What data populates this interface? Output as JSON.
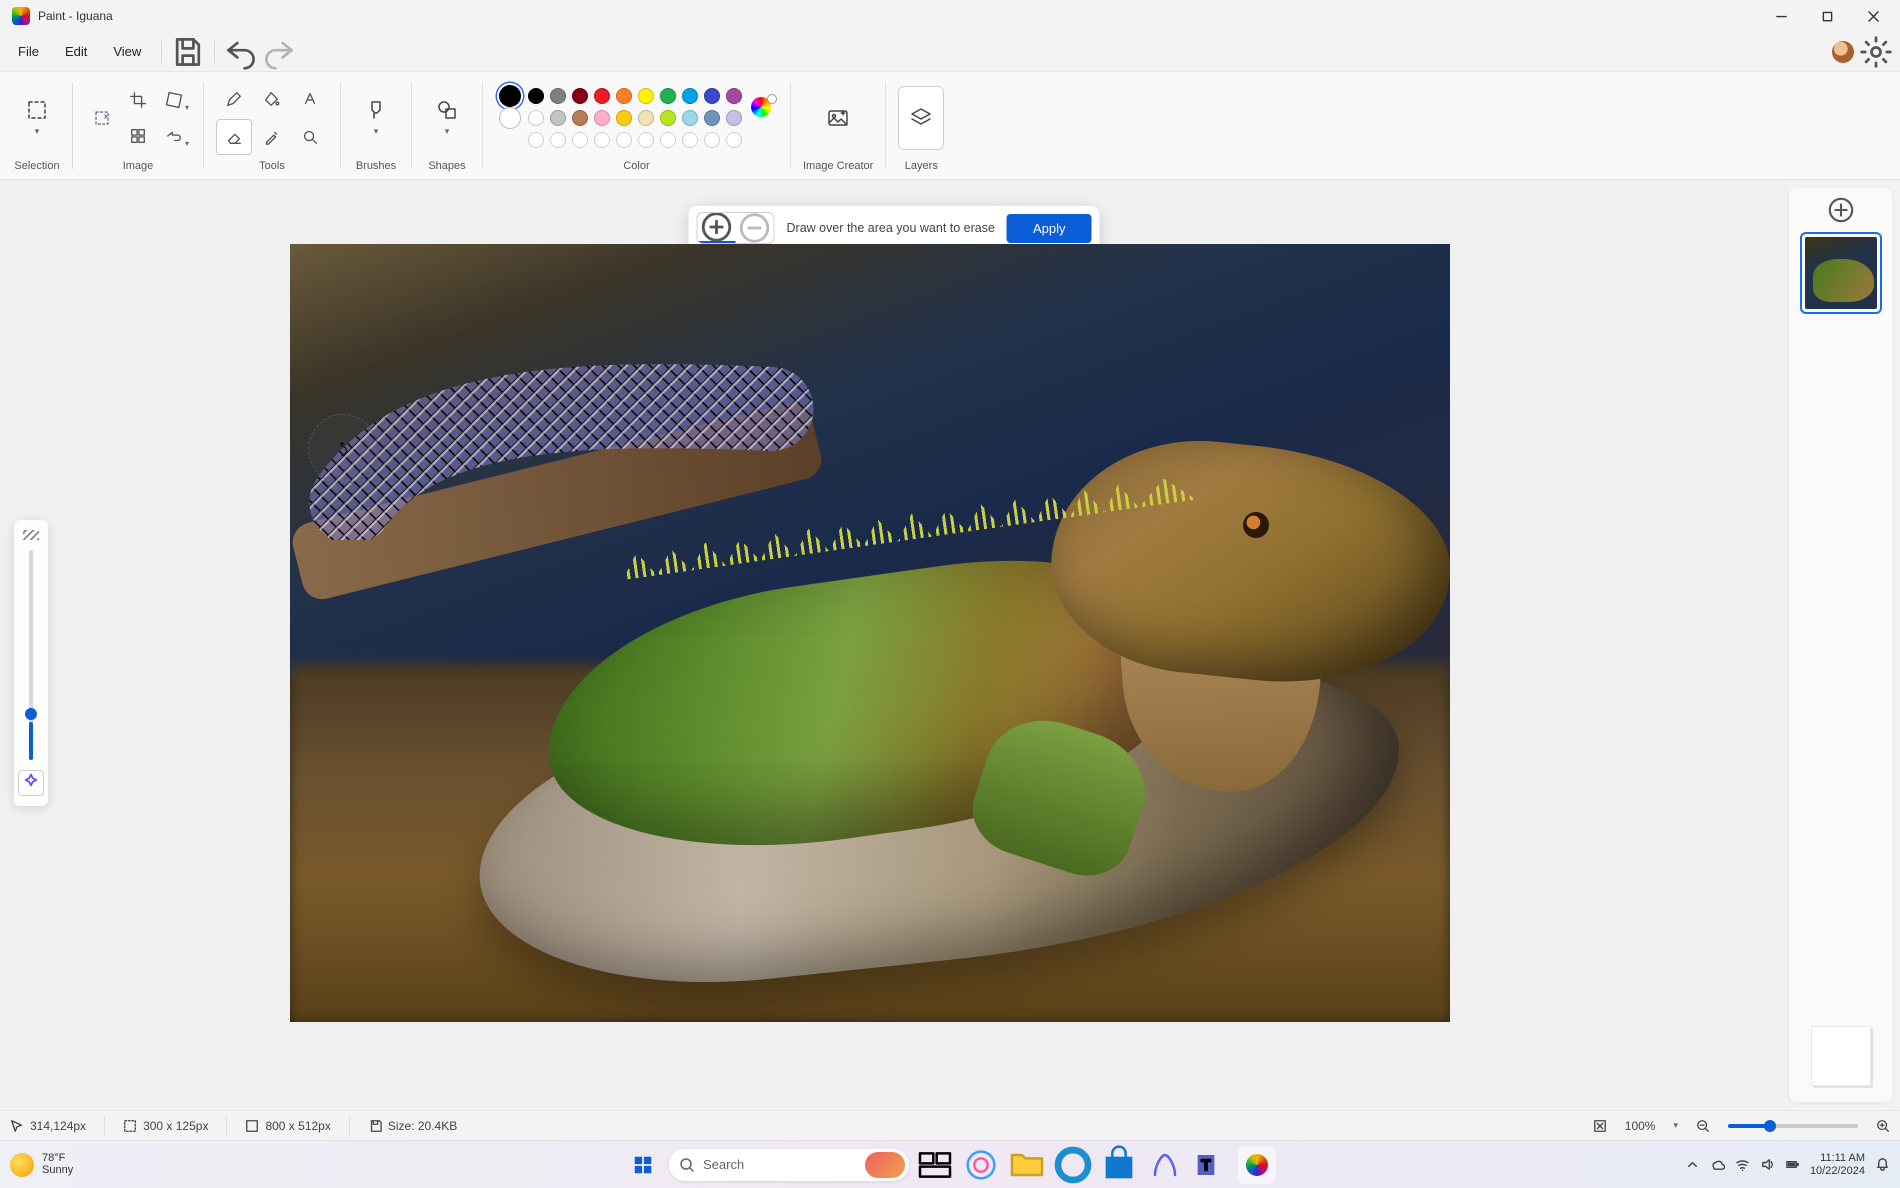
{
  "titlebar": {
    "title": "Paint - Iguana"
  },
  "menubar": {
    "file": "File",
    "edit": "Edit",
    "view": "View"
  },
  "ribbon": {
    "selection": "Selection",
    "image": "Image",
    "tools": "Tools",
    "brushes": "Brushes",
    "shapes": "Shapes",
    "color": "Color",
    "image_creator": "Image Creator",
    "layers": "Layers"
  },
  "colors": {
    "primary": "#000000",
    "secondary": "#ffffff",
    "row1": [
      "#000000",
      "#7f7f7f",
      "#880015",
      "#ed1c24",
      "#ff7f27",
      "#fff200",
      "#22b14c",
      "#00a2e8",
      "#3f48cc",
      "#a349a4"
    ],
    "row2": [
      "#ffffff",
      "#c3c3c3",
      "#b97a57",
      "#ffaec9",
      "#ffc90e",
      "#efe4b0",
      "#b5e61d",
      "#99d9ea",
      "#7092be",
      "#c8bfe7"
    ]
  },
  "erase_bar": {
    "hint": "Draw over the area you want to erase",
    "apply": "Apply"
  },
  "status": {
    "cursor_pos": "314,124px",
    "selection_size": "300  x  125px",
    "canvas_size": "800  x  512px",
    "file_size": "Size: 20.4KB",
    "zoom": "100%"
  },
  "taskbar": {
    "temp": "78°F",
    "cond": "Sunny",
    "search_placeholder": "Search",
    "time": "11:11 AM",
    "date": "10/22/2024"
  }
}
